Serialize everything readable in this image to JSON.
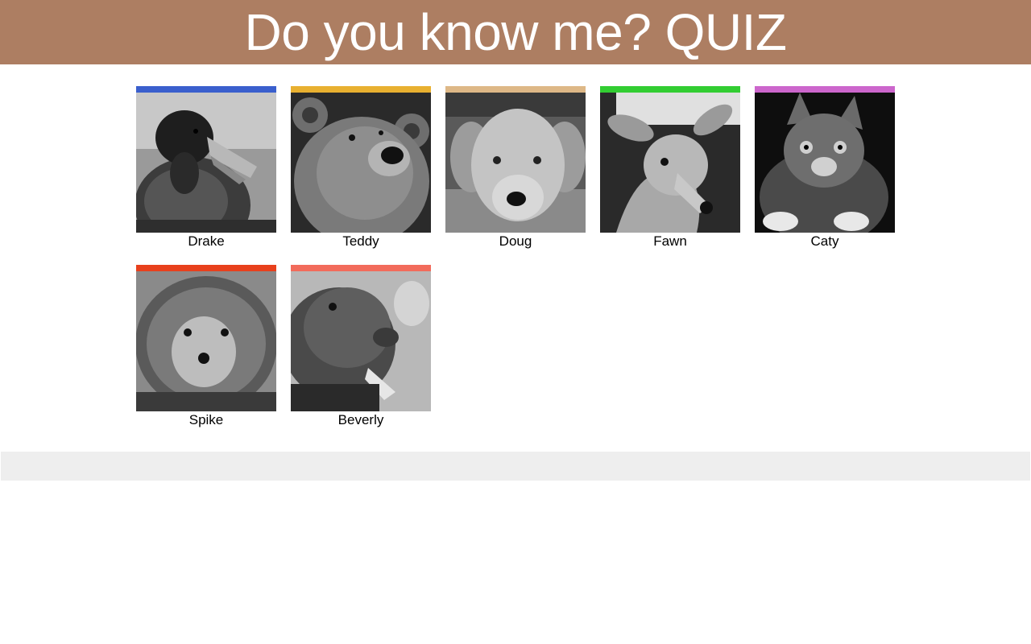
{
  "header": {
    "title": "Do you know me? QUIZ",
    "background": "#ad7e62"
  },
  "cards": [
    {
      "name": "Drake",
      "accent": "#3a5fcd",
      "icon": "duck-photo"
    },
    {
      "name": "Teddy",
      "accent": "#e8b030",
      "icon": "bear-photo"
    },
    {
      "name": "Doug",
      "accent": "#deb887",
      "icon": "dog-photo"
    },
    {
      "name": "Fawn",
      "accent": "#32cd32",
      "icon": "deer-photo"
    },
    {
      "name": "Caty",
      "accent": "#cc66cc",
      "icon": "cat-photo"
    },
    {
      "name": "Spike",
      "accent": "#e8401c",
      "icon": "hedgehog-photo"
    },
    {
      "name": "Beverly",
      "accent": "#f26b5b",
      "icon": "beaver-photo"
    }
  ],
  "footer": {
    "background": "#eeeeee"
  }
}
